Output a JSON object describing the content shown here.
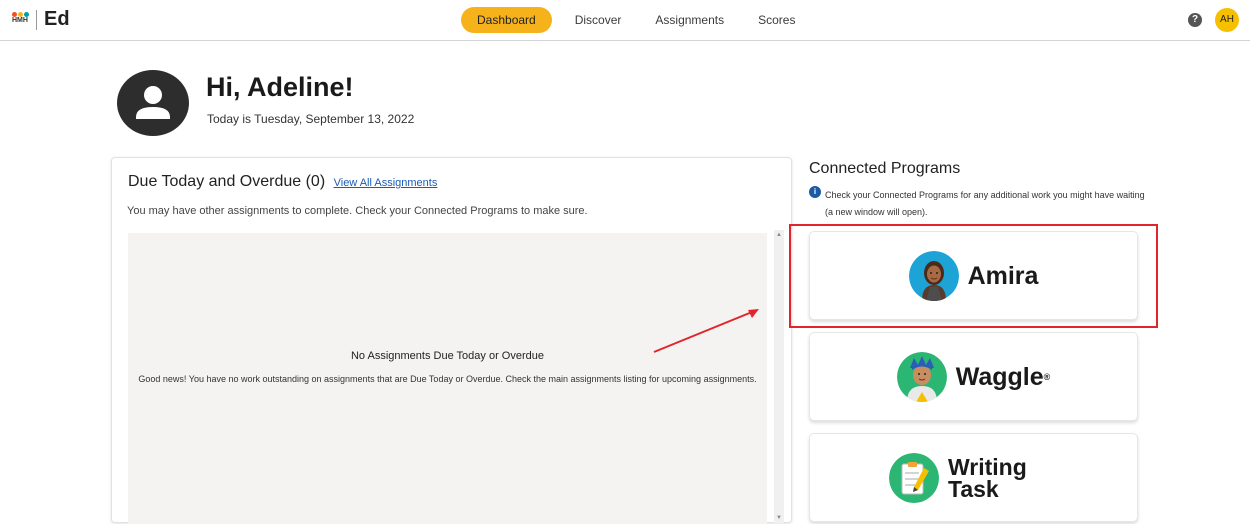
{
  "header": {
    "logo_brand": "HMH",
    "logo_app": "Ed",
    "nav": [
      {
        "label": "Dashboard",
        "active": true
      },
      {
        "label": "Discover",
        "active": false
      },
      {
        "label": "Assignments",
        "active": false
      },
      {
        "label": "Scores",
        "active": false
      }
    ],
    "help_icon": "question-circle-icon",
    "avatar_initials": "AH",
    "accent_color": "#f6b21b"
  },
  "greeting": {
    "title": "Hi, Adeline!",
    "date": "Today is Tuesday, September 13, 2022"
  },
  "due": {
    "title": "Due Today and Overdue (0)",
    "link": "View All Assignments",
    "subtitle": "You may have other assignments to complete. Check your Connected Programs to make sure.",
    "empty_title": "No Assignments Due Today or Overdue",
    "empty_text": "Good news! You have no work outstanding on assignments that are Due Today or Overdue. Check the main assignments listing for upcoming assignments."
  },
  "connected": {
    "title": "Connected Programs",
    "note": "Check your Connected Programs for any additional work you might have waiting (a new window will open).",
    "programs": [
      {
        "name": "Amira",
        "icon": "amira-avatar-icon"
      },
      {
        "name": "Waggle",
        "icon": "waggle-avatar-icon",
        "mark": "®"
      },
      {
        "name": "Writing Task",
        "icon": "writing-task-icon"
      }
    ]
  },
  "annotation_color": "#e0252b"
}
